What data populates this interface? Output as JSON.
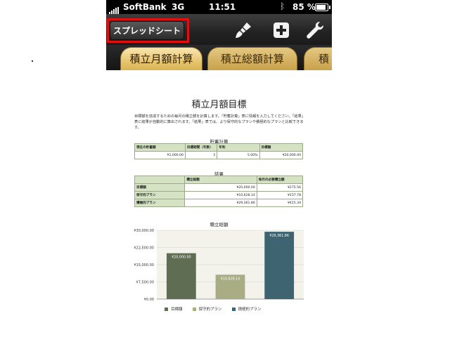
{
  "status_bar": {
    "carrier": "SoftBank",
    "network": "3G",
    "time": "11:51",
    "battery": "85 %",
    "battery_level": 0.85
  },
  "toolbar": {
    "spreadsheet_button": "スプレッドシート",
    "icons": [
      "paintbrush-icon",
      "add-icon",
      "wrench-icon"
    ]
  },
  "tabs": [
    {
      "label": "積立月額計算",
      "active": true
    },
    {
      "label": "積立総額計算",
      "active": false
    },
    {
      "label": "積",
      "active": false
    }
  ],
  "sheet": {
    "title": "積立月額目標",
    "description": "目標額を達成するための毎月の積立額を計算します。「貯蓄計算」表に情報を入力してください。「結果」表に結果が自動的に算出されます。「結果」表では、より保守的なプランや積極的なプランと比較できます。",
    "savings": {
      "title": "貯蓄計算",
      "headers": [
        "現在の貯蓄額",
        "目標期間（年数）",
        "年利",
        "目標額"
      ],
      "row": [
        "¥1,000.00",
        "5",
        "5.00%",
        "¥20,000.00"
      ]
    },
    "results": {
      "title": "結果",
      "headers": [
        "",
        "積立総額",
        "毎月の必要積立額"
      ],
      "rows": [
        [
          "目標額",
          "¥20,000.00",
          "¥275.56"
        ],
        [
          "保守的プラン",
          "¥10,628.14",
          "¥157.78"
        ],
        [
          "積極的プラン",
          "¥29,361.86",
          "¥415.34"
        ]
      ]
    }
  },
  "chart_data": {
    "type": "bar",
    "title": "積立総額",
    "categories": [
      "目標額",
      "保守的プラン",
      "積極的プラン"
    ],
    "values": [
      20000.0,
      10628.14,
      29361.86
    ],
    "value_labels": [
      "¥20,000.00",
      "¥10,628.14",
      "¥29,361.86"
    ],
    "colors": [
      "#5f6d52",
      "#a9ad84",
      "#3d6470"
    ],
    "ylim": [
      0,
      30000
    ],
    "yticks": [
      0,
      7500,
      15000,
      22500,
      30000
    ],
    "ytick_labels": [
      "¥0.00",
      "¥7,500.00",
      "¥15,000.00",
      "¥22,500.00",
      "¥30,000.00"
    ],
    "legend": [
      "目標額",
      "保守的プラン",
      "積極的プラン"
    ],
    "legend_position": "bottom"
  }
}
